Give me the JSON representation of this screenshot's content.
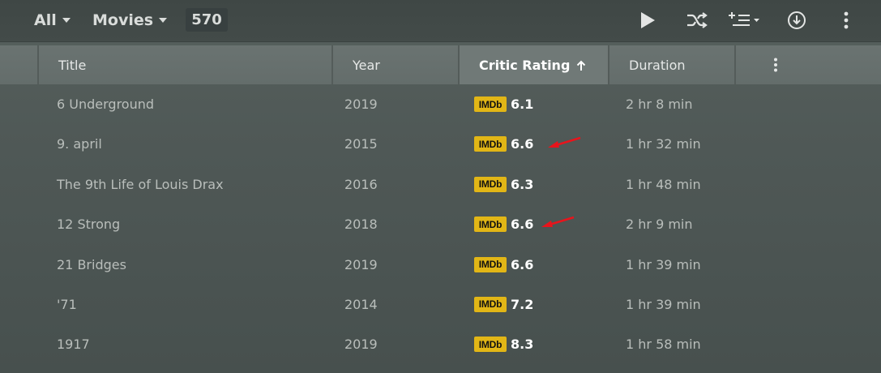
{
  "toolbar": {
    "filter_label": "All",
    "type_label": "Movies",
    "count": "570",
    "icons": [
      "play-icon",
      "shuffle-icon",
      "playlist-add-icon",
      "download-icon",
      "more-vertical-icon"
    ]
  },
  "columns": {
    "title": "Title",
    "year": "Year",
    "critic_rating": "Critic Rating",
    "duration": "Duration",
    "sort_column": "Critic Rating",
    "sort_direction": "ascending"
  },
  "rating_badge": "IMDb",
  "rows": [
    {
      "title": "6 Underground",
      "year": "2019",
      "rating": "6.1",
      "duration": "2 hr 8 min"
    },
    {
      "title": "9. april",
      "year": "2015",
      "rating": "6.6",
      "duration": "1 hr 32 min"
    },
    {
      "title": "The 9th Life of Louis Drax",
      "year": "2016",
      "rating": "6.3",
      "duration": "1 hr 48 min"
    },
    {
      "title": "12 Strong",
      "year": "2018",
      "rating": "6.6",
      "duration": "2 hr 9 min"
    },
    {
      "title": "21 Bridges",
      "year": "2019",
      "rating": "6.6",
      "duration": "1 hr 39 min"
    },
    {
      "title": "'71",
      "year": "2014",
      "rating": "7.2",
      "duration": "1 hr 39 min"
    },
    {
      "title": "1917",
      "year": "2019",
      "rating": "8.3",
      "duration": "1 hr 58 min"
    }
  ],
  "annotations": {
    "arrow_color": "#e8141c",
    "arrows_on_rows": [
      "9. april",
      "12 Strong"
    ]
  },
  "colors": {
    "imdb_yellow": "#e2b616",
    "background": "#4f5856",
    "header": "#646d6b"
  }
}
